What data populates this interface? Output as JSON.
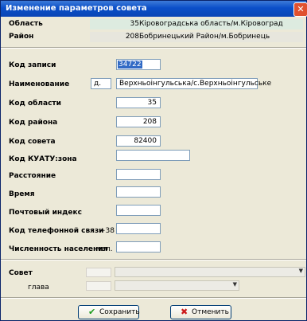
{
  "window": {
    "title": "Изменение параметров совета"
  },
  "header": {
    "region_label": "Область",
    "region_code": "35",
    "region_name": "Кіровоградська область/м.Кіровоград",
    "district_label": "Район",
    "district_code": "208",
    "district_name": "Бобринецький Район/м.Бобринець"
  },
  "form": {
    "record_code_label": "Код записи",
    "record_code_value": "34722",
    "name_label": "Наименование",
    "name_prefix": "д.",
    "name_value": "Верхньоінгульська/с.Верхньоінгульське",
    "region_code_label": "Код области",
    "region_code_value": "35",
    "district_code_label": "Код района",
    "district_code_value": "208",
    "council_code_label": "Код совета",
    "council_code_value": "82400",
    "koatuu_label": "Код КУАТУ:зона",
    "koatuu_value": "",
    "distance_label": "Расстояние",
    "distance_value": "",
    "time_label": "Время",
    "time_value": "",
    "postcode_label": "Почтовый индекс",
    "postcode_value": "",
    "phone_code_label": "Код телефонной связи",
    "phone_prefix": "+38",
    "phone_value": "",
    "population_label": "Численность населения",
    "population_unit": "чел.",
    "population_value": ""
  },
  "bottom": {
    "council_label": "Совет",
    "council_value": "",
    "head_label": "глава",
    "head_value": ""
  },
  "buttons": {
    "save_label": "Сохранить",
    "cancel_label": "Отменить"
  }
}
